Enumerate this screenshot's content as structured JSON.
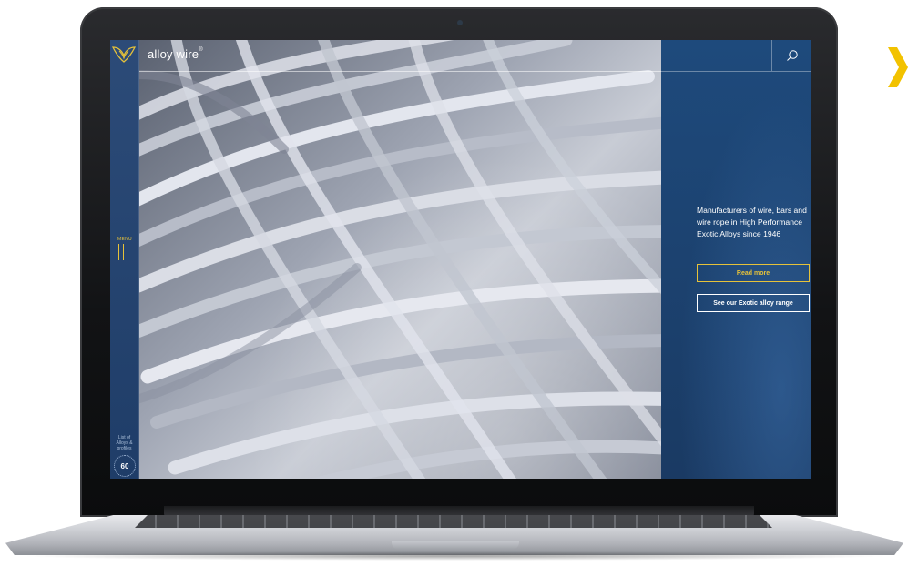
{
  "header": {
    "brand": "alloy wire",
    "brand_mark": "®",
    "search_icon": "search-icon"
  },
  "sidebar": {
    "menu_label": "MENU",
    "alloy_list_text": [
      "List of",
      "Alloys &",
      "profiles"
    ],
    "badge_text": "60"
  },
  "hero": {
    "tagline": "Manufacturers of wire, bars and wire rope in High Performance Exotic Alloys since 1946",
    "read_more_label": "Read more",
    "range_label": "See our Exotic alloy range"
  },
  "colors": {
    "accent": "#e6c23a",
    "panel_blue": "#1e4a7c",
    "sidebar_blue": "#2c4b78",
    "page_chevron": "#f2c200"
  }
}
